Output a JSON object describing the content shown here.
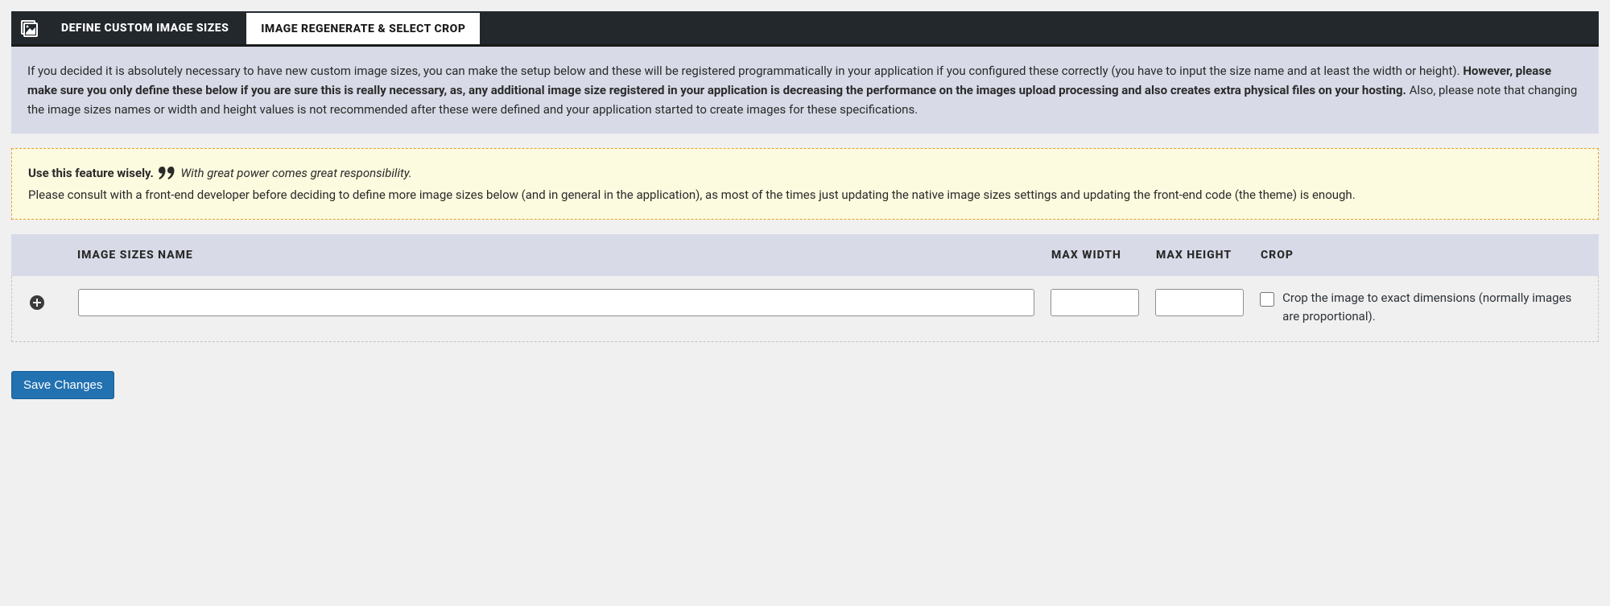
{
  "tabs": {
    "active": "DEFINE CUSTOM IMAGE SIZES",
    "inactive": "IMAGE REGENERATE & SELECT CROP"
  },
  "info": {
    "part1": "If you decided it is absolutely necessary to have new custom image sizes, you can make the setup below and these will be registered programmatically in your application if you configured these correctly (you have to input the size name and at least the width or height). ",
    "bold": "However, please make sure you only define these below if you are sure this is really necessary, as, any additional image size registered in your application is decreasing the performance on the images upload processing and also creates extra physical files on your hosting.",
    "part2": " Also, please note that changing the image sizes names or width and height values is not recommended after these were defined and your application started to create images for these specifications."
  },
  "warn": {
    "lead": "Use this feature wisely.",
    "quote": "With great power comes great responsibility.",
    "body": "Please consult with a front-end developer before deciding to define more image sizes below (and in general in the application), as most of the times just updating the native image sizes settings and updating the front-end code (the theme) is enough."
  },
  "table": {
    "headers": {
      "name": "IMAGE SIZES NAME",
      "max_width": "MAX WIDTH",
      "max_height": "MAX HEIGHT",
      "crop": "CROP"
    },
    "row": {
      "name_value": "",
      "max_width_value": "",
      "max_height_value": "",
      "crop_checked": false,
      "crop_label": "Crop the image to exact dimensions (normally images are proportional)."
    }
  },
  "buttons": {
    "save": "Save Changes"
  }
}
